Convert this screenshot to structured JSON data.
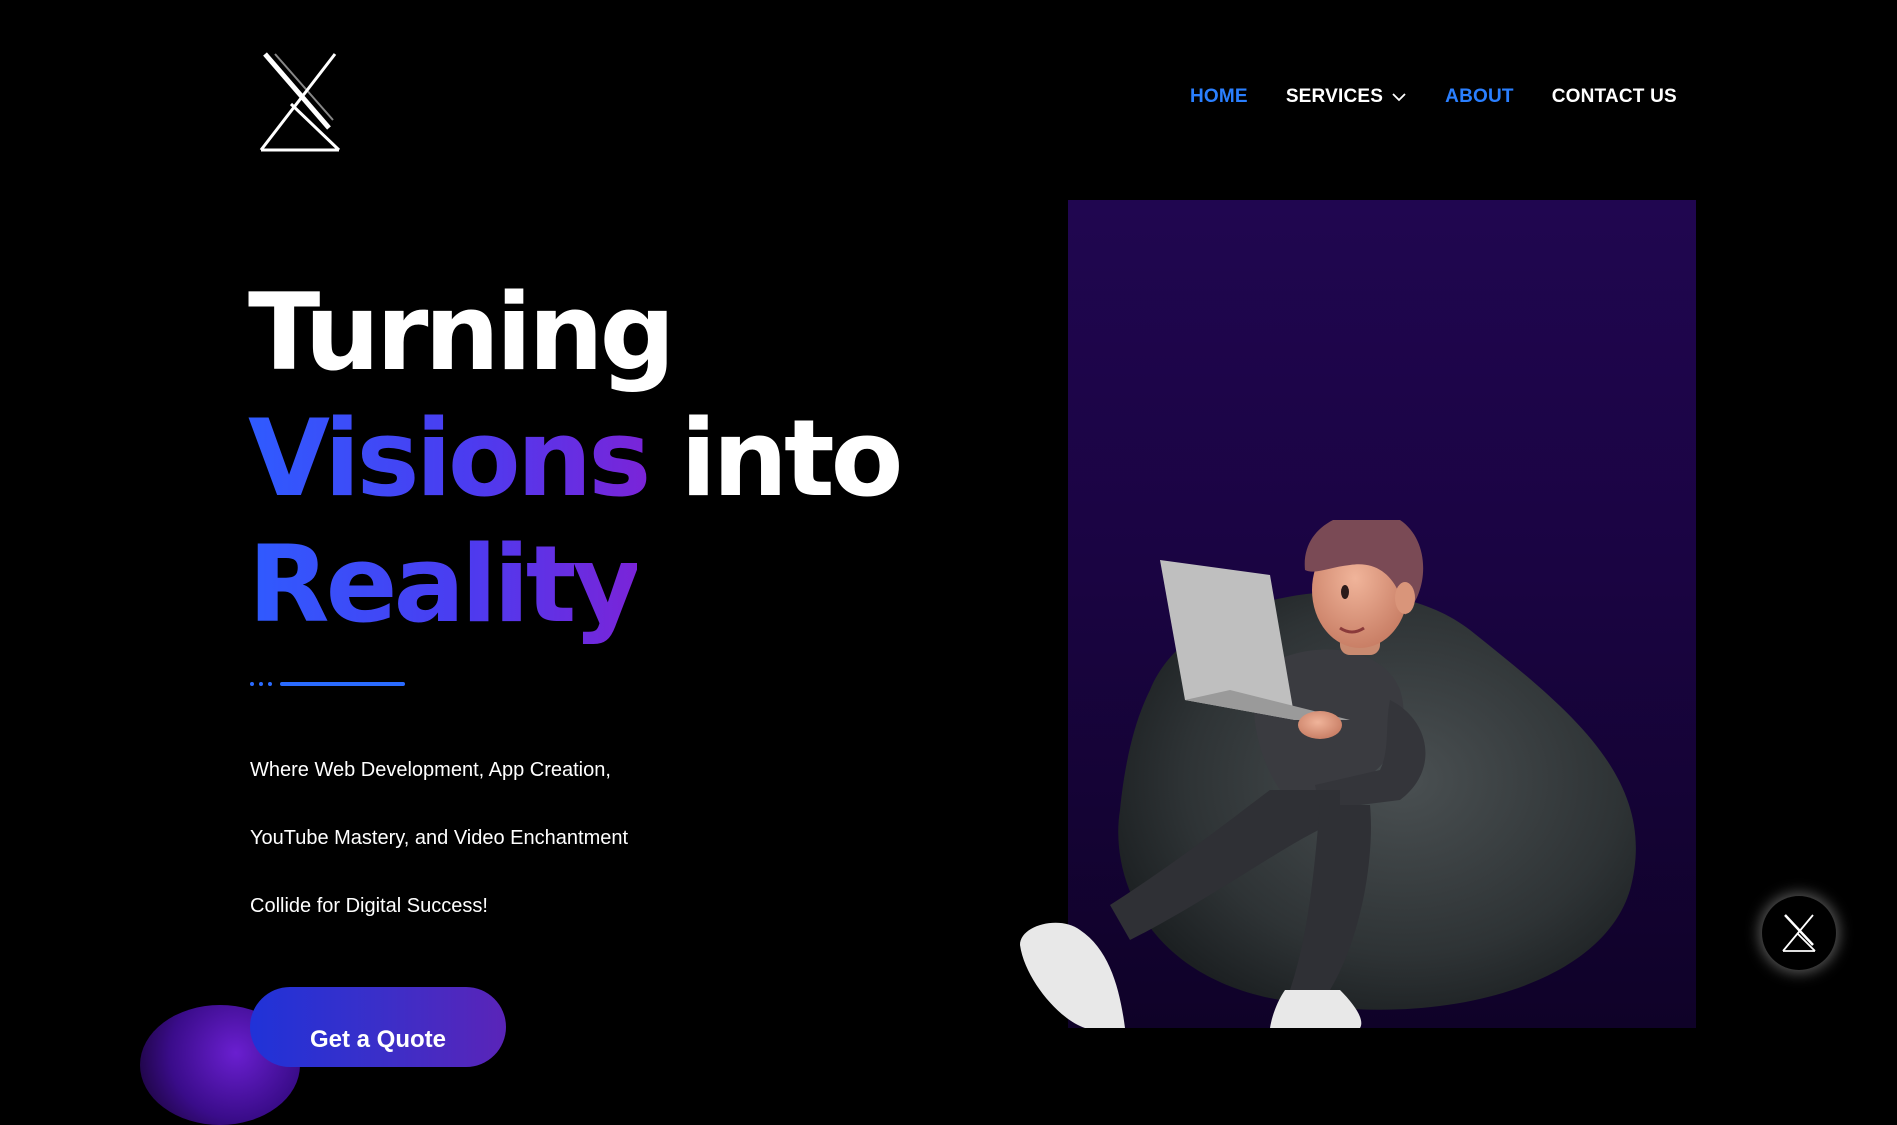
{
  "brand": {
    "logo_icon": "x-logo-icon"
  },
  "nav": {
    "items": [
      {
        "label": "HOME",
        "active": true
      },
      {
        "label": "SERVICES",
        "has_dropdown": true,
        "dropdown_icon": "chevron-down-icon"
      },
      {
        "label": "ABOUT",
        "active": true
      },
      {
        "label": "CONTACT US"
      }
    ],
    "active_color": "#2a7fff"
  },
  "hero": {
    "title_line1": "Turning",
    "title_line2_accent": "Visions",
    "title_line2_rest": "into",
    "title_line3_accent": "Reality",
    "subtitle_lines": [
      "Where Web Development, App Creation,",
      "YouTube Mastery, and Video Enchantment",
      "Collide for Digital Success!"
    ],
    "cta_label": "Get a Quote",
    "illustration_icon": "person-on-beanbag-with-laptop-icon"
  },
  "floating_button": {
    "icon": "x-logo-icon"
  },
  "colors": {
    "background": "#000000",
    "accent_blue": "#2f5bff",
    "accent_purple": "#7a24d8",
    "panel_top": "#200650",
    "panel_bottom": "#0f0228"
  }
}
